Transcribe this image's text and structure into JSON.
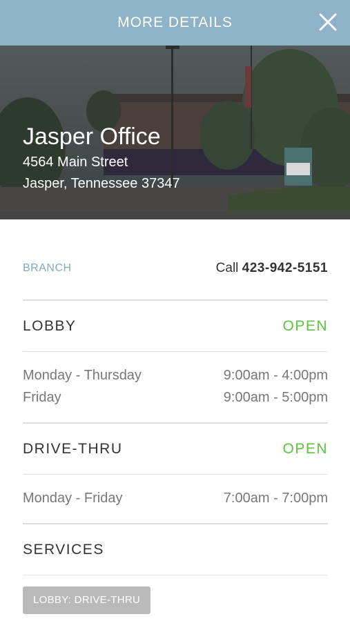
{
  "header": {
    "title": "MORE DETAILS",
    "close_icon": "close-icon"
  },
  "hero": {
    "office_name": "Jasper Office",
    "address_line1": "4564 Main Street",
    "address_line2": "Jasper, Tennessee 37347"
  },
  "branch": {
    "label": "BRANCH",
    "call_prefix": "Call",
    "phone": "423-942-5151"
  },
  "lobby": {
    "title": "LOBBY",
    "status": "OPEN",
    "hours": [
      {
        "days": "Monday - Thursday",
        "time": "9:00am - 4:00pm"
      },
      {
        "days": "Friday",
        "time": "9:00am - 5:00pm"
      }
    ]
  },
  "drive_thru": {
    "title": "DRIVE-THRU",
    "status": "OPEN",
    "hours": [
      {
        "days": "Monday - Friday",
        "time": "7:00am - 7:00pm"
      }
    ]
  },
  "services": {
    "title": "SERVICES",
    "tags": [
      "LOBBY: DRIVE-THRU"
    ]
  },
  "colors": {
    "header_bg": "#8fb3c6",
    "open_status": "#5fc33d",
    "branch_label": "#7fa9c1",
    "tag_bg": "#b9b9b9"
  }
}
